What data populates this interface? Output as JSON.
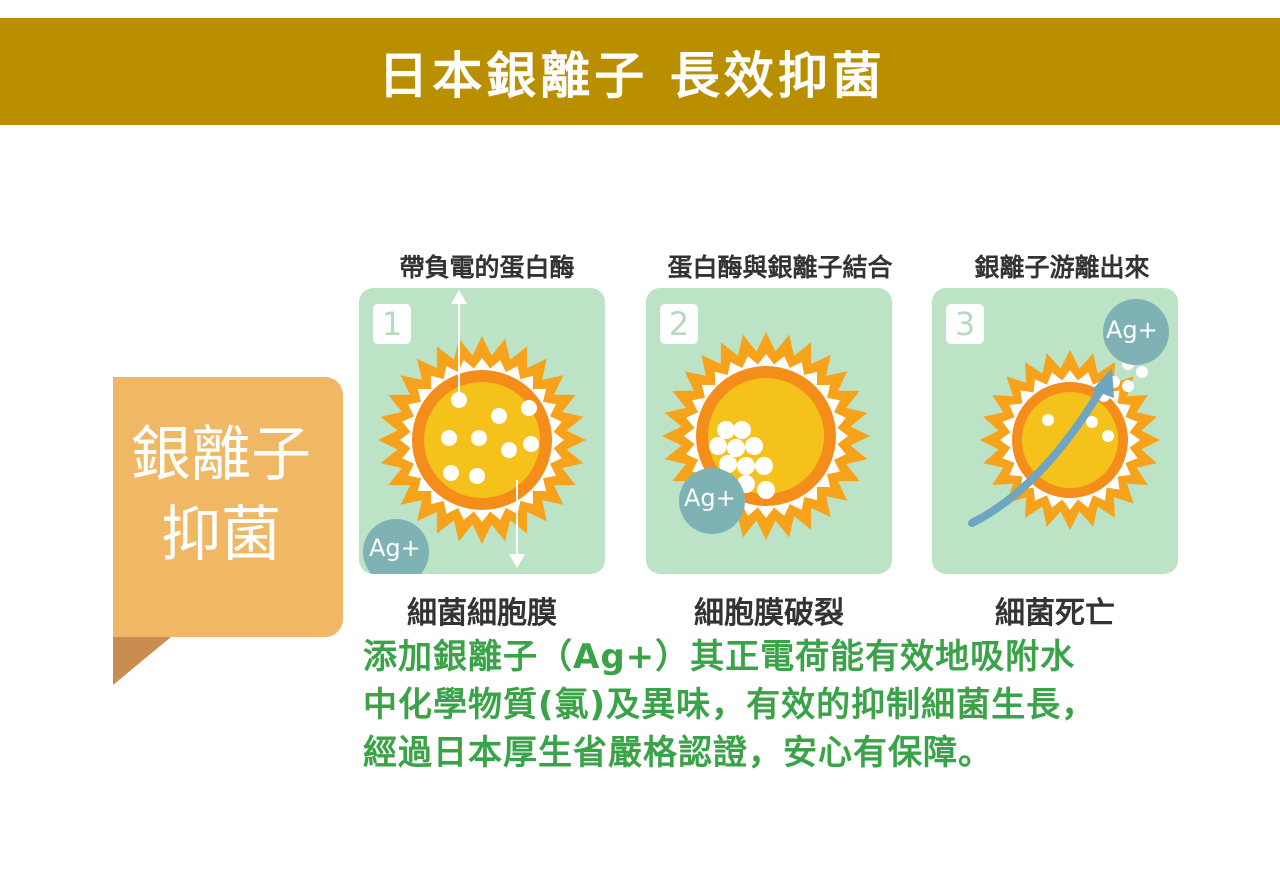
{
  "banner": {
    "title": "日本銀離子 長效抑菌"
  },
  "side_tab": {
    "line1": "銀離子",
    "line2": "抑菌"
  },
  "steps": [
    {
      "number": "1",
      "caption": "帶負電的蛋白酶",
      "label": "細菌細胞膜",
      "ion": "Ag+"
    },
    {
      "number": "2",
      "caption": "蛋白酶與銀離子結合",
      "label": "細胞膜破裂",
      "ion": "Ag+"
    },
    {
      "number": "3",
      "caption": "銀離子游離出來",
      "label": "細菌死亡",
      "ion": "Ag+"
    }
  ],
  "description": {
    "line1": "添加銀離子（Ag+）其正電荷能有效地吸附水",
    "line2": "中化學物質(氯)及異味，有效的抑制細菌生長，",
    "line3": "經過日本厚生省嚴格認證，安心有保障。"
  },
  "colors": {
    "banner": "#b98f00",
    "side_tab": "#f0b865",
    "panel": "#bde3c7",
    "ion_circle": "#7fb2b5",
    "sun_outer": "#f7a21b",
    "sun_inner": "#f4c21b",
    "desc_text": "#3aa348"
  },
  "icons": [
    "arrow-up-icon",
    "arrow-down-icon",
    "bacteria-icon",
    "ag-ion-icon",
    "swoosh-arrow-icon"
  ]
}
